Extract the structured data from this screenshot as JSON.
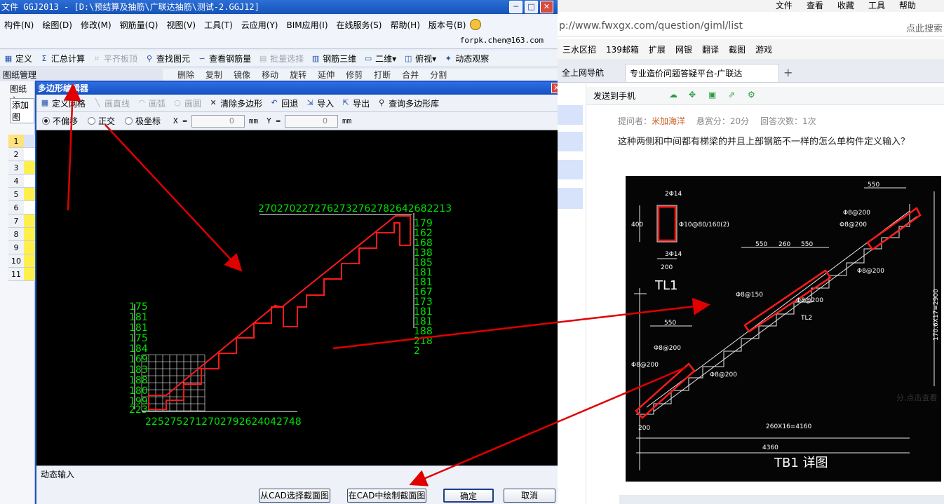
{
  "app": {
    "title": "文件 GGJ2013 - [D:\\预结算及抽筋\\广联达抽筋\\测试-2.GGJ12]",
    "menu": [
      "构件(N)",
      "绘图(D)",
      "修改(M)",
      "钢筋量(Q)",
      "视图(V)",
      "工具(T)",
      "云应用(Y)",
      "BIM应用(I)",
      "在线服务(S)",
      "帮助(H)",
      "版本号(B)"
    ],
    "user_email": "forpk.chen@163.com",
    "toolbar": [
      "定义",
      "汇总计算",
      "平齐板顶",
      "查找图元",
      "查看钢筋量",
      "批量选择",
      "钢筋三维",
      "二维",
      "俯视",
      "动态观察"
    ],
    "toolbar2": [
      "删除",
      "复制",
      "镜像",
      "移动",
      "旋转",
      "延伸",
      "修剪",
      "打断",
      "合并",
      "分割"
    ],
    "panel_title": "图纸管理",
    "panel_tab": "图纸文",
    "panel_add": "添加图",
    "row_numbers": [
      "1",
      "2",
      "3",
      "4",
      "5",
      "6",
      "7",
      "8",
      "9",
      "10",
      "11"
    ]
  },
  "dialog": {
    "title": "多边形编辑器",
    "toolbar": [
      "定义网格",
      "画直线",
      "画弧",
      "画圆",
      "清除多边形",
      "回退",
      "导入",
      "导出",
      "查询多边形库"
    ],
    "options": {
      "no_offset": "不偏移",
      "orthogonal": "正交",
      "polar": "极坐标",
      "x_label": "X =",
      "y_label": "Y =",
      "x_value": "0",
      "y_value": "0",
      "unit": "mm"
    },
    "canvas": {
      "top_dims": "2702702272762732762782642682213",
      "right_dims": [
        "179",
        "162",
        "168",
        "138",
        "185",
        "181",
        "181",
        "167",
        "173",
        "181",
        "181",
        "188",
        "218",
        "2"
      ],
      "left_dims": [
        "175",
        "181",
        "181",
        "175",
        "184",
        "169",
        "183",
        "188",
        "180",
        "199",
        "223"
      ],
      "bottom_dims": "2252752712702792624042748"
    },
    "dynamic_input": "动态输入",
    "buttons": {
      "from_cad": "从CAD选择截面图",
      "draw_cad": "在CAD中绘制截面图",
      "ok": "确定",
      "cancel": "取消"
    }
  },
  "browser": {
    "menu": [
      "文件",
      "查看",
      "收藏",
      "工具",
      "帮助"
    ],
    "url": "p://www.fwxgx.com/question/giml/list",
    "search_placeholder": "点此搜索",
    "bookmarks": [
      "三水区招",
      "139邮箱",
      "扩展",
      "网银",
      "翻译",
      "截图",
      "游戏"
    ],
    "tabs": [
      "全上网导航",
      "专业造价问题答疑平台-广联达"
    ],
    "send_to_phone": "发送到手机",
    "meta": {
      "asker_label": "提问者：",
      "asker": "米加海洋",
      "reward": "悬赏分：20分",
      "answers": "回答次数：1次"
    },
    "question": "这种两侧和中间都有梯梁的并且上部钢筋不一样的怎么单构件定义输入？",
    "cad": {
      "title": "TB1 详图",
      "tl": "TL1",
      "dim_top": "550",
      "dims_mid": [
        "550",
        "260",
        "550"
      ],
      "bar1": "2Φ14",
      "bar2": "3Φ14",
      "stirrup": "Φ10@80/160(2)",
      "width": "200",
      "height": "400",
      "dim_bottom1": "260X16=4160",
      "dim_bottom2": "4360",
      "left200": "200",
      "vert": "170.6X17=2900",
      "rebar_labels": [
        "Φ8@200",
        "Φ8@200",
        "Φ8@200",
        "Φ8@150",
        "Φ8@200",
        "Φ8@200",
        "Φ8@200",
        "Φ8@200"
      ],
      "tl2": "TL2",
      "d550": "550"
    },
    "snippet": "分,点击查看"
  },
  "colors": {
    "title_blue": "#1553b8",
    "dialog_border": "#1d55c5",
    "cad_green": "#00e000",
    "poly_red": "#ff1a1a",
    "arrow_red": "#e00000"
  }
}
